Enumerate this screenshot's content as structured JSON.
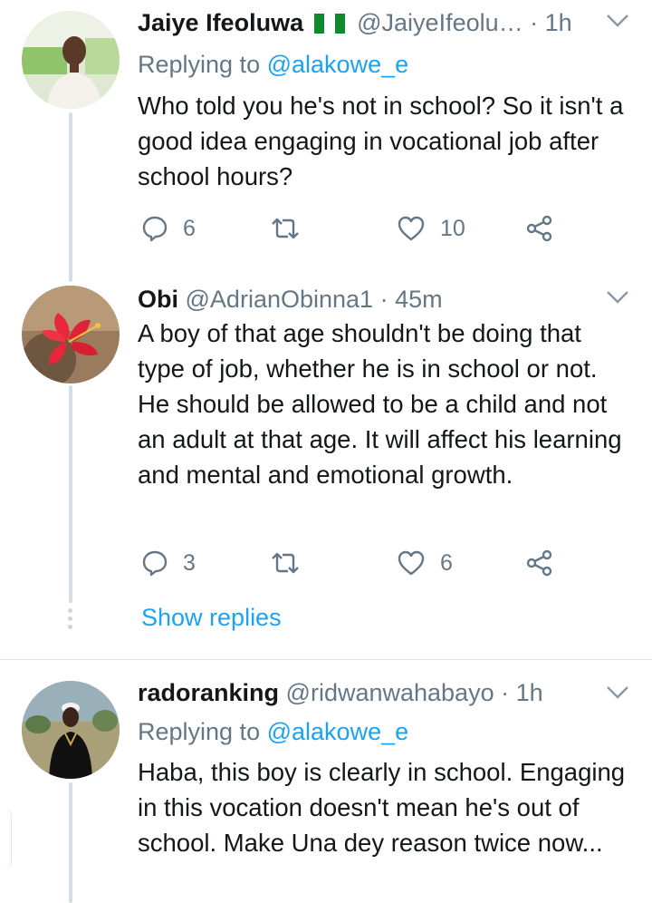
{
  "tweets": [
    {
      "name": "Jaiye Ifeoluwa",
      "flag": "🇳🇬",
      "handle": "@JaiyeIfeolu…",
      "time": "· 1h",
      "replying_prefix": "Replying to",
      "replying_to": "@alakowe_e",
      "text": "Who told you he's not in school? So it isn't a good idea engaging in vocational job after school hours?",
      "reply_count": "6",
      "retweet_count": "",
      "like_count": "10"
    },
    {
      "name": "Obi",
      "handle": "@AdrianObinna1",
      "time": "· 45m",
      "text": "A boy of that age shouldn't be doing that type of job, whether he is in school or not. He should be allowed to be a child and not an adult at that age. It will affect his learning and mental and emotional growth.",
      "reply_count": "3",
      "retweet_count": "",
      "like_count": "6",
      "show_replies": "Show replies"
    },
    {
      "name": "radoranking",
      "handle": "@ridwanwahabayo",
      "time": "· 1h",
      "replying_prefix": "Replying to",
      "replying_to": "@alakowe_e",
      "text": "Haba, this boy is clearly in school. Engaging in this vocation doesn't mean he's out of school. Make Una dey reason twice now..."
    }
  ],
  "icons": {
    "reply": "reply-icon",
    "retweet": "retweet-icon",
    "like": "heart-icon",
    "share": "share-icon",
    "more": "chevron-down-icon"
  },
  "colors": {
    "link": "#1da1f2",
    "secondary": "#657786",
    "text": "#14171a",
    "thread_line": "#d6dde3"
  }
}
